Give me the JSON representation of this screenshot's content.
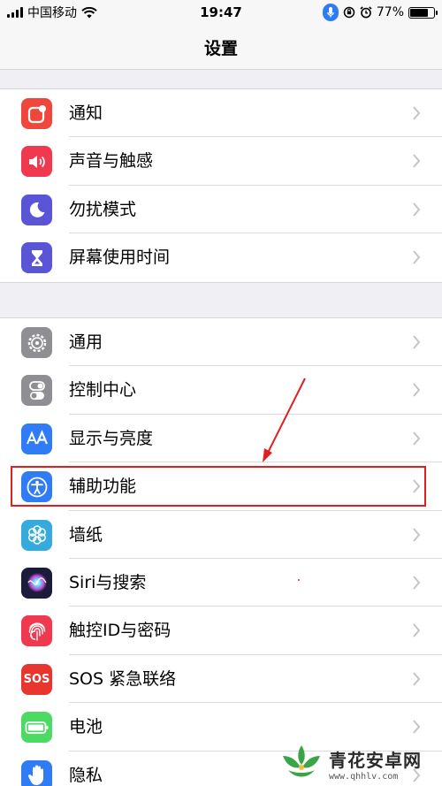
{
  "status_bar": {
    "carrier": "中国移动",
    "time": "19:47",
    "battery_percent": "77%",
    "battery_level": 0.77
  },
  "header": {
    "title": "设置"
  },
  "groups": [
    {
      "items": [
        {
          "label": "通知",
          "icon": "notification-icon",
          "color": "#f0473c"
        },
        {
          "label": "声音与触感",
          "icon": "speaker-icon",
          "color": "#f0384f"
        },
        {
          "label": "勿扰模式",
          "icon": "moon-icon",
          "color": "#5a55d6"
        },
        {
          "label": "屏幕使用时间",
          "icon": "hourglass-icon",
          "color": "#5a55d6"
        }
      ]
    },
    {
      "items": [
        {
          "label": "通用",
          "icon": "gear-icon",
          "color": "#8e8e93"
        },
        {
          "label": "控制中心",
          "icon": "toggles-icon",
          "color": "#8e8e93"
        },
        {
          "label": "显示与亮度",
          "icon": "text-size-icon",
          "color": "#2f7cf6"
        },
        {
          "label": "辅助功能",
          "icon": "accessibility-icon",
          "color": "#2f7cf6"
        },
        {
          "label": "墙纸",
          "icon": "flower-icon",
          "color": "#36aadc"
        },
        {
          "label": "Siri与搜索",
          "icon": "siri-icon",
          "color": "#1c1c3a"
        },
        {
          "label": "触控ID与密码",
          "icon": "fingerprint-icon",
          "color": "#f0384f"
        },
        {
          "label": "SOS 紧急联络",
          "icon": "sos-icon",
          "color": "#e8362f",
          "icon_text": "SOS"
        },
        {
          "label": "电池",
          "icon": "battery-icon",
          "color": "#4cd964"
        },
        {
          "label": "隐私",
          "icon": "hand-icon",
          "color": "#2f7cf6"
        }
      ]
    }
  ],
  "watermark": {
    "name": "青花安卓网",
    "url": "www.qhhlv.com"
  }
}
